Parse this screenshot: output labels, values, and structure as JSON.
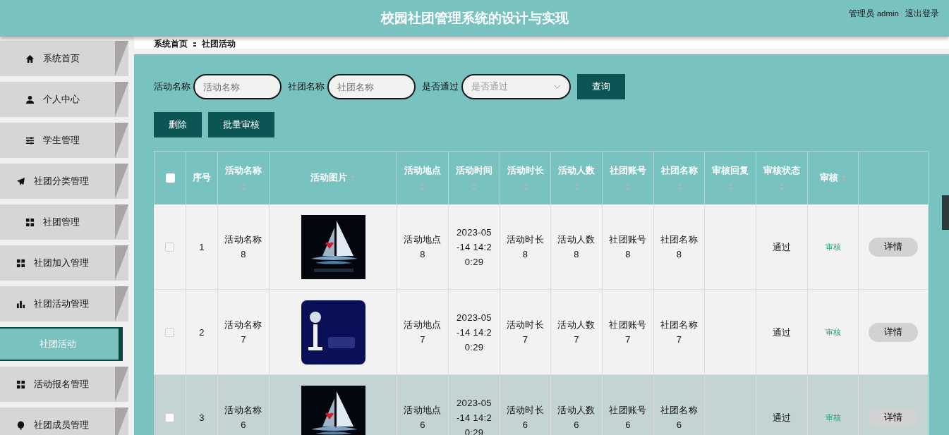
{
  "header": {
    "title": "校园社团管理系统的设计与实现",
    "user": "管理员 admin",
    "logout": "退出登录"
  },
  "sidebar": {
    "items": [
      {
        "label": "系统首页",
        "kind": "menu",
        "selected": false
      },
      {
        "label": "个人中心",
        "kind": "menu",
        "selected": false
      },
      {
        "label": "学生管理",
        "kind": "menu",
        "selected": false
      },
      {
        "label": "社团分类管理",
        "kind": "menu",
        "selected": false
      },
      {
        "label": "社团管理",
        "kind": "menu",
        "selected": false
      },
      {
        "label": "社团加入管理",
        "kind": "menu",
        "selected": false
      },
      {
        "label": "社团活动管理",
        "kind": "menu",
        "selected": false
      },
      {
        "label": "社团活动",
        "kind": "submenu",
        "selected": true
      },
      {
        "label": "活动报名管理",
        "kind": "menu",
        "selected": false
      },
      {
        "label": "社团成员管理",
        "kind": "menu",
        "selected": false
      }
    ]
  },
  "breadcrumb": [
    "系统首页",
    "社团活动"
  ],
  "search": {
    "fields": [
      {
        "label": "活动名称",
        "placeholder": "活动名称",
        "kind": "input"
      },
      {
        "label": "社团名称",
        "placeholder": "社团名称",
        "kind": "input"
      },
      {
        "label": "是否通过",
        "placeholder": "是否通过",
        "kind": "select"
      }
    ],
    "button": "查询"
  },
  "actions": [
    "删除",
    "批量审核"
  ],
  "table": {
    "columns": [
      {
        "kind": "check"
      },
      {
        "label": "序号",
        "kind": "index",
        "sortable": false
      },
      {
        "label": "活动名称",
        "kind": "text",
        "sortable": true
      },
      {
        "label": "活动图片",
        "sortable": true
      },
      {
        "label": "活动地点",
        "kind": "text",
        "sortable": true
      },
      {
        "label": "活动时间",
        "kind": "text",
        "sortable": true
      },
      {
        "label": "活动时长",
        "kind": "text",
        "sortable": true
      },
      {
        "label": "活动人数",
        "kind": "text",
        "sortable": true
      },
      {
        "label": "社团账号",
        "kind": "text",
        "sortable": true
      },
      {
        "label": "社团名称",
        "kind": "text",
        "sortable": true
      },
      {
        "label": "审核回复",
        "kind": "text",
        "sortable": true
      },
      {
        "label": "审核状态",
        "kind": "text",
        "sortable": true
      },
      {
        "label": "审核",
        "kind": "audit",
        "sortable": true
      },
      {
        "kind": "detail"
      }
    ],
    "all_checked": false,
    "rows": [
      {
        "checked": false,
        "highlighted": false,
        "cells": [
          "",
          "1",
          "活动名称8",
          "",
          "活动地点8",
          "2023-05-14 14:20:29",
          "活动时长8",
          "活动人数8",
          "社团账号8",
          "社团名称8",
          "",
          "通过",
          "审核",
          "详情"
        ]
      },
      {
        "checked": false,
        "highlighted": false,
        "cells": [
          "",
          "2",
          "活动名称7",
          "",
          "活动地点7",
          "2023-05-14 14:20:29",
          "活动时长7",
          "活动人数7",
          "社团账号7",
          "社团名称7",
          "",
          "通过",
          "审核",
          "详情"
        ]
      },
      {
        "checked": false,
        "highlighted": true,
        "cells": [
          "",
          "3",
          "活动名称6",
          "",
          "活动地点6",
          "2023-05-14 14:20:29",
          "活动时长6",
          "活动人数6",
          "社团账号6",
          "社团名称6",
          "",
          "通过",
          "审核",
          "详情"
        ]
      }
    ]
  }
}
